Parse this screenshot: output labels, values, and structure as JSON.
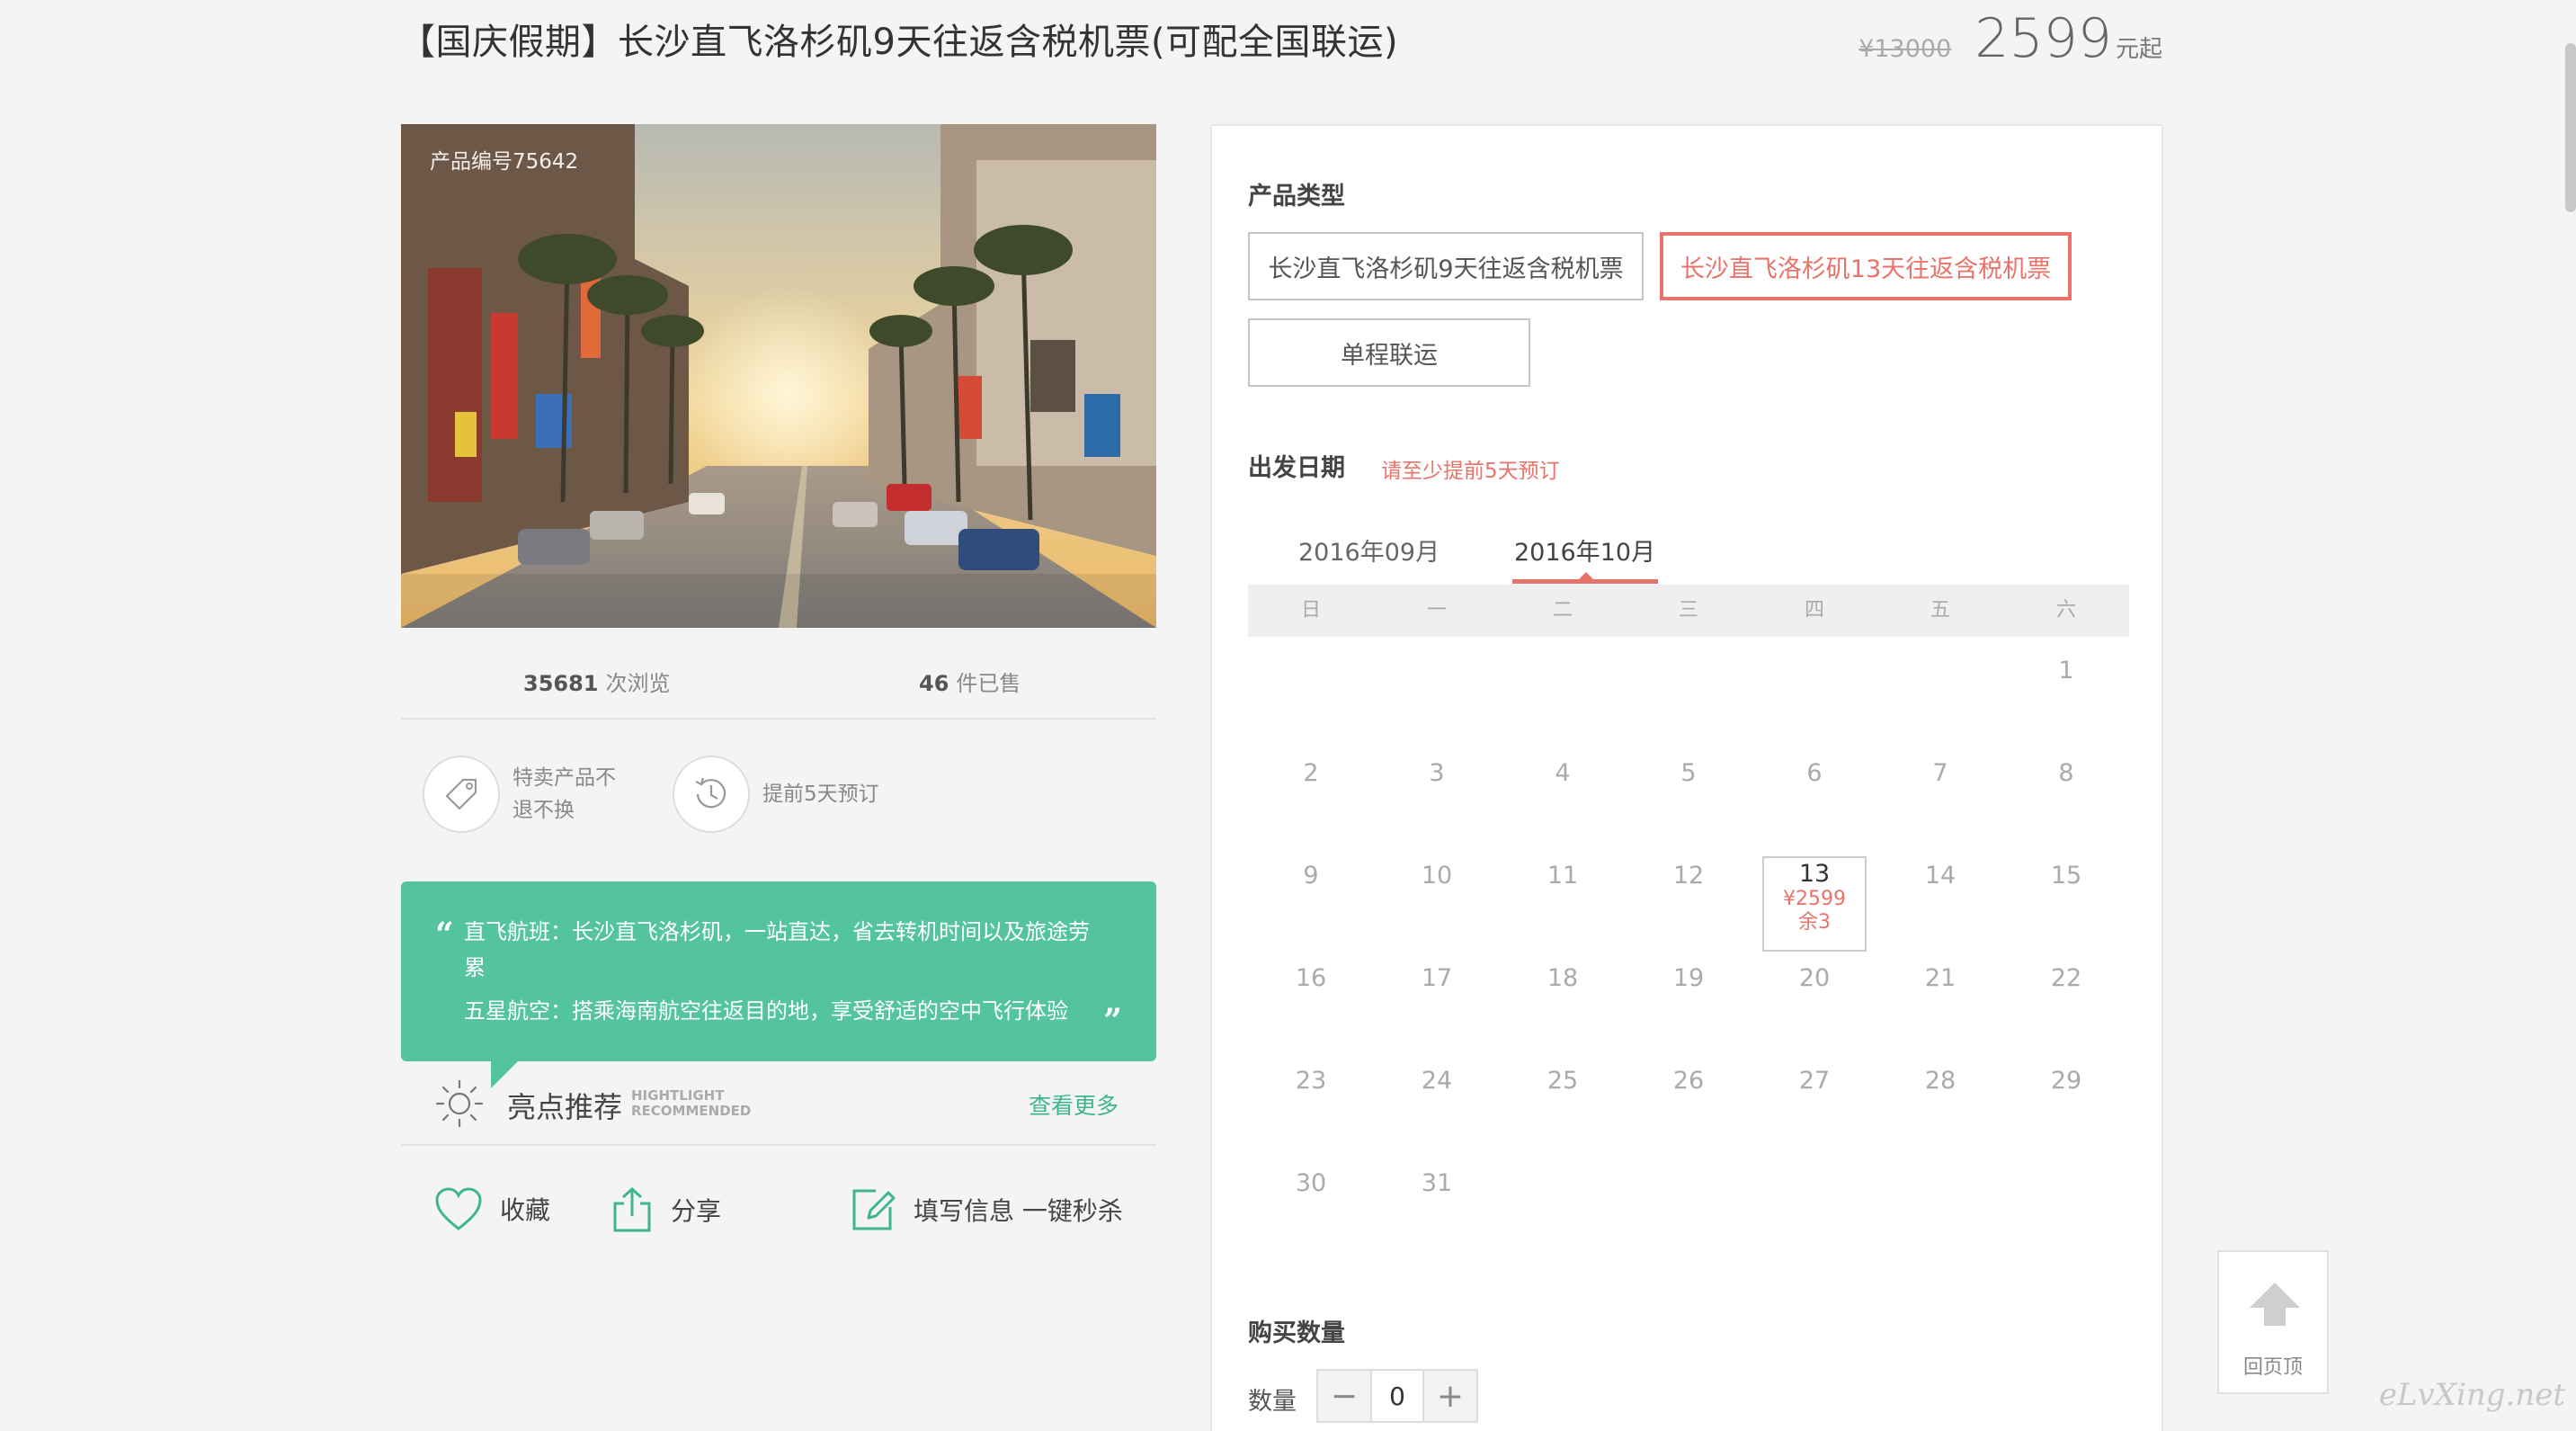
{
  "header": {
    "title": "【国庆假期】长沙直飞洛杉矶9天往返含税机票(可配全国联运)",
    "old_price": "¥13000",
    "price": "2599",
    "price_suffix": "元起"
  },
  "product": {
    "id_label": "产品编号75642",
    "views_count": "35681",
    "views_label": "次浏览",
    "sold_count": "46",
    "sold_label": "件已售"
  },
  "features": [
    {
      "icon": "tag-icon",
      "text": "特卖产品不退不换"
    },
    {
      "icon": "clock-history-icon",
      "text": "提前5天预订"
    }
  ],
  "quote": {
    "line1": "直飞航班：长沙直飞洛杉矶，一站直达，省去转机时间以及旅途劳累",
    "line2": "五星航空：搭乘海南航空往返目的地，享受舒适的空中飞行体验"
  },
  "highlight": {
    "title": "亮点推荐",
    "en_line1": "HIGHTLIGHT",
    "en_line2": "RECOMMENDED",
    "more": "查看更多"
  },
  "actions": {
    "favorite": "收藏",
    "share": "分享",
    "fill_info": "填写信息 一键秒杀"
  },
  "booking": {
    "type_title": "产品类型",
    "options": [
      "长沙直飞洛杉矶9天往返含税机票",
      "长沙直飞洛杉矶13天往返含税机票",
      "单程联运"
    ],
    "selected_option": "长沙直飞洛杉矶13天往返含税机票",
    "date_title": "出发日期",
    "date_note": "请至少提前5天预订",
    "months": [
      "2016年09月",
      "2016年10月"
    ],
    "active_month": "2016年10月",
    "weekdays": [
      "日",
      "一",
      "二",
      "三",
      "四",
      "五",
      "六"
    ],
    "calendar_rows": [
      [
        "",
        "",
        "",
        "",
        "",
        "",
        "1"
      ],
      [
        "2",
        "3",
        "4",
        "5",
        "6",
        "7",
        "8"
      ],
      [
        "9",
        "10",
        "11",
        "12",
        "13",
        "14",
        "15"
      ],
      [
        "16",
        "17",
        "18",
        "19",
        "20",
        "21",
        "22"
      ],
      [
        "23",
        "24",
        "25",
        "26",
        "27",
        "28",
        "29"
      ],
      [
        "30",
        "31",
        "",
        "",
        "",
        "",
        ""
      ]
    ],
    "available_day": {
      "day": "13",
      "price": "¥2599",
      "stock": "余3"
    },
    "qty_title": "购买数量",
    "qty_label": "数量",
    "qty_value": "0",
    "minus": "−",
    "plus": "+"
  },
  "back_to_top": "回页顶",
  "watermark": "eLvXing.net",
  "colors": {
    "accent": "#e8736a",
    "green": "#54c4a0",
    "link_green": "#3fb58d"
  }
}
